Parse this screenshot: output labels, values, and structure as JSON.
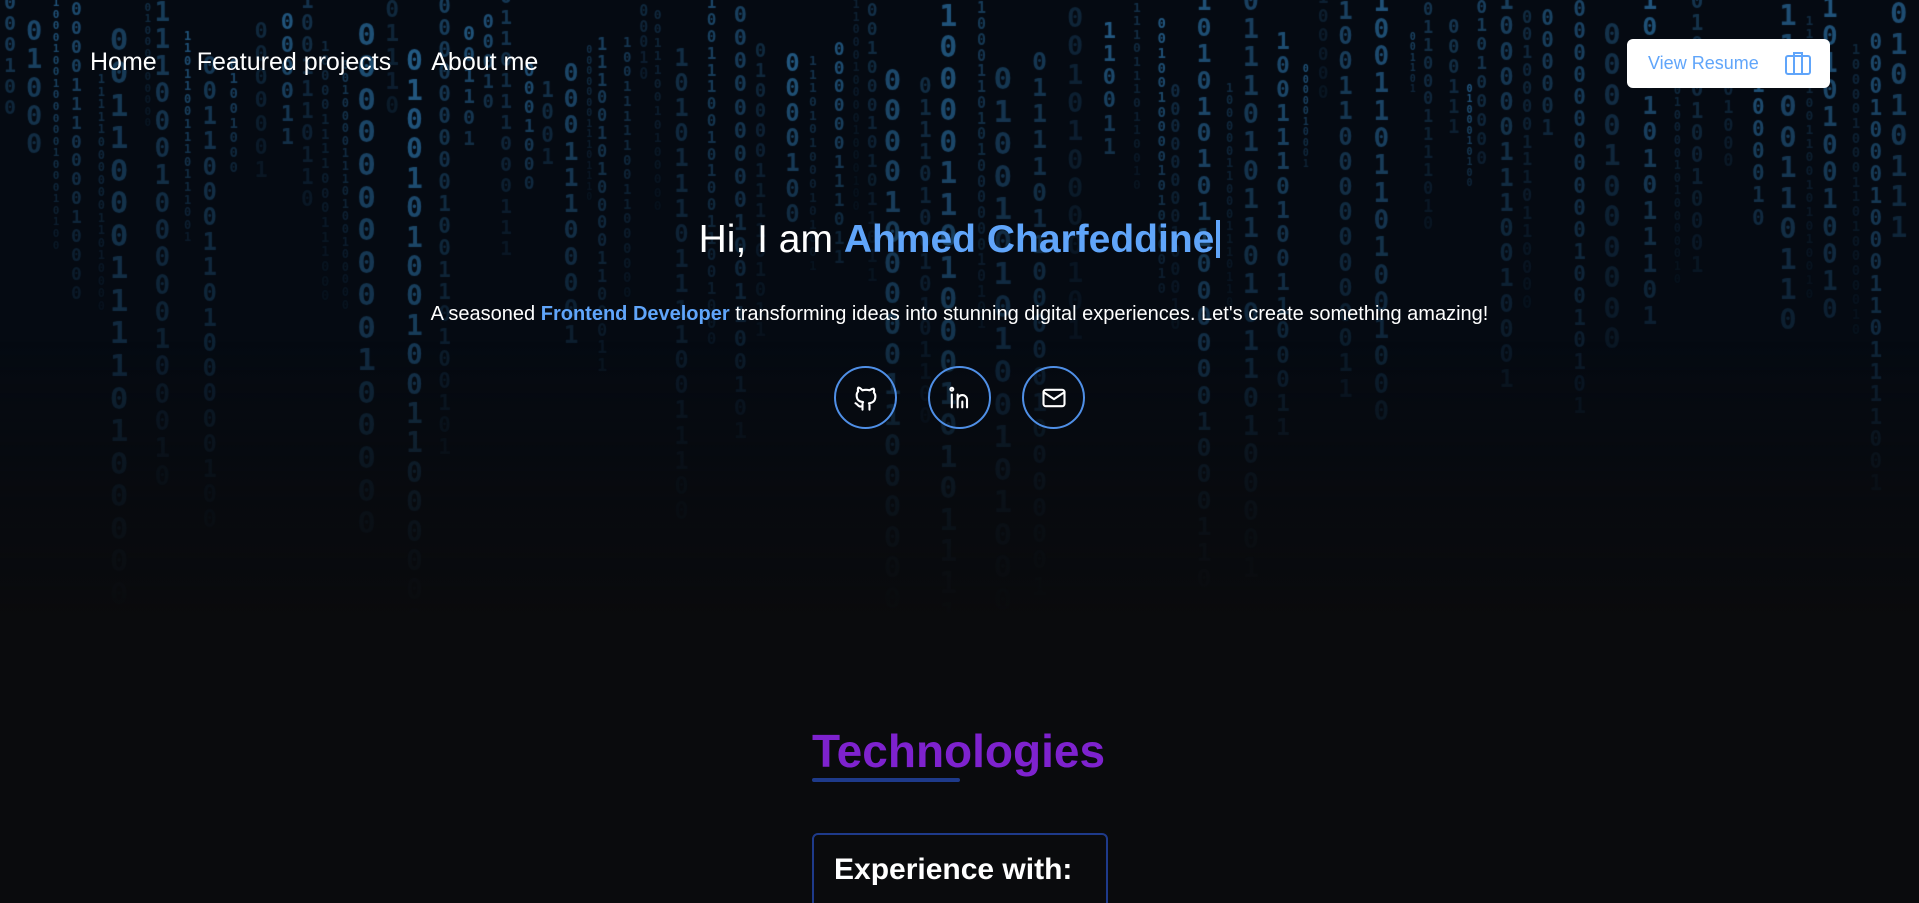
{
  "nav": {
    "items": [
      "Home",
      "Featured projects",
      "About me"
    ]
  },
  "resume_button": {
    "label": "View Resume",
    "icon": "briefcase-icon"
  },
  "hero": {
    "greeting": "Hi, I am ",
    "name": "Ahmed Charfeddine",
    "tagline_prefix": "A seasoned ",
    "tagline_role": "Frontend Developer",
    "tagline_suffix": " transforming ideas into stunning digital experiences. Let's create something amazing!",
    "socials": [
      {
        "name": "github",
        "icon": "github-icon"
      },
      {
        "name": "linkedin",
        "icon": "linkedin-icon"
      },
      {
        "name": "email",
        "icon": "mail-icon"
      }
    ]
  },
  "technologies": {
    "title": "Technologies",
    "card_title": "Experience with:"
  },
  "colors": {
    "accent": "#60a5fa",
    "section_title": "#7e22ce",
    "underline": "#1e3a8a",
    "background": "#0a0b0d",
    "matrix_digits": "#2b6ea0"
  }
}
